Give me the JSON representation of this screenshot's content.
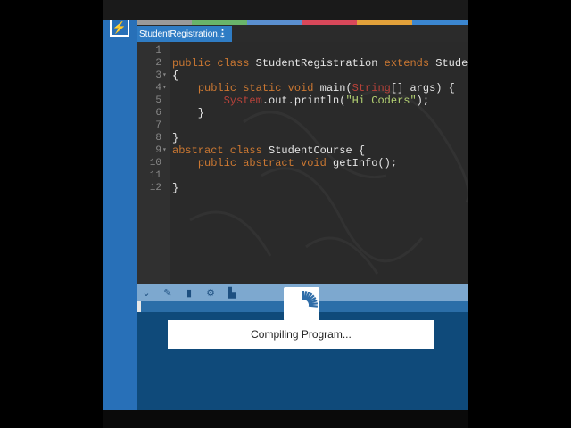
{
  "tab": {
    "title": "StudentRegistration...",
    "menu_glyph": "⋮"
  },
  "rail": {
    "button_glyph": "⚡"
  },
  "colors": {
    "strip": [
      "#9a9a9a",
      "#69b46a",
      "#5a8fd0",
      "#d9485a",
      "#e2a13a",
      "#3b86d0"
    ]
  },
  "code_lines": [
    {
      "n": "1",
      "fold": "",
      "segs": []
    },
    {
      "n": "2",
      "fold": "",
      "segs": [
        [
          "kw",
          "public class "
        ],
        [
          "cls",
          "StudentRegistration "
        ],
        [
          "kw",
          "extends "
        ],
        [
          "cls",
          "Student"
        ]
      ]
    },
    {
      "n": "3",
      "fold": "▾",
      "segs": [
        [
          "cls",
          "{"
        ]
      ]
    },
    {
      "n": "4",
      "fold": "▾",
      "segs": [
        [
          "cls",
          "    "
        ],
        [
          "kw",
          "public static void "
        ],
        [
          "cls",
          "main("
        ],
        [
          "typ",
          "String"
        ],
        [
          "cls",
          "[] args) {"
        ]
      ]
    },
    {
      "n": "5",
      "fold": "",
      "segs": [
        [
          "cls",
          "        "
        ],
        [
          "typ",
          "System"
        ],
        [
          "cls",
          ".out.println("
        ],
        [
          "str",
          "\"Hi Coders\""
        ],
        [
          "cls",
          ");"
        ]
      ]
    },
    {
      "n": "6",
      "fold": "",
      "segs": [
        [
          "cls",
          "    }"
        ]
      ]
    },
    {
      "n": "7",
      "fold": "",
      "segs": []
    },
    {
      "n": "8",
      "fold": "",
      "segs": [
        [
          "cls",
          "}"
        ]
      ]
    },
    {
      "n": "9",
      "fold": "▾",
      "segs": [
        [
          "kw",
          "abstract class "
        ],
        [
          "cls",
          "StudentCourse {"
        ]
      ]
    },
    {
      "n": "10",
      "fold": "",
      "segs": [
        [
          "cls",
          "    "
        ],
        [
          "kw",
          "public abstract void "
        ],
        [
          "cls",
          "getInfo();"
        ]
      ]
    },
    {
      "n": "11",
      "fold": "",
      "segs": []
    },
    {
      "n": "12",
      "fold": "",
      "segs": [
        [
          "cls",
          "}"
        ]
      ]
    }
  ],
  "toolbar": {
    "icons": [
      {
        "name": "collapse-chevron-icon",
        "glyph": "⌄"
      },
      {
        "name": "edit-pencil-icon",
        "glyph": "✎"
      },
      {
        "name": "clipboard-icon",
        "glyph": "▮"
      },
      {
        "name": "settings-gear-icon",
        "glyph": "⚙"
      },
      {
        "name": "save-icon",
        "glyph": "▙"
      }
    ]
  },
  "status": {
    "message": "Compiling Program..."
  }
}
